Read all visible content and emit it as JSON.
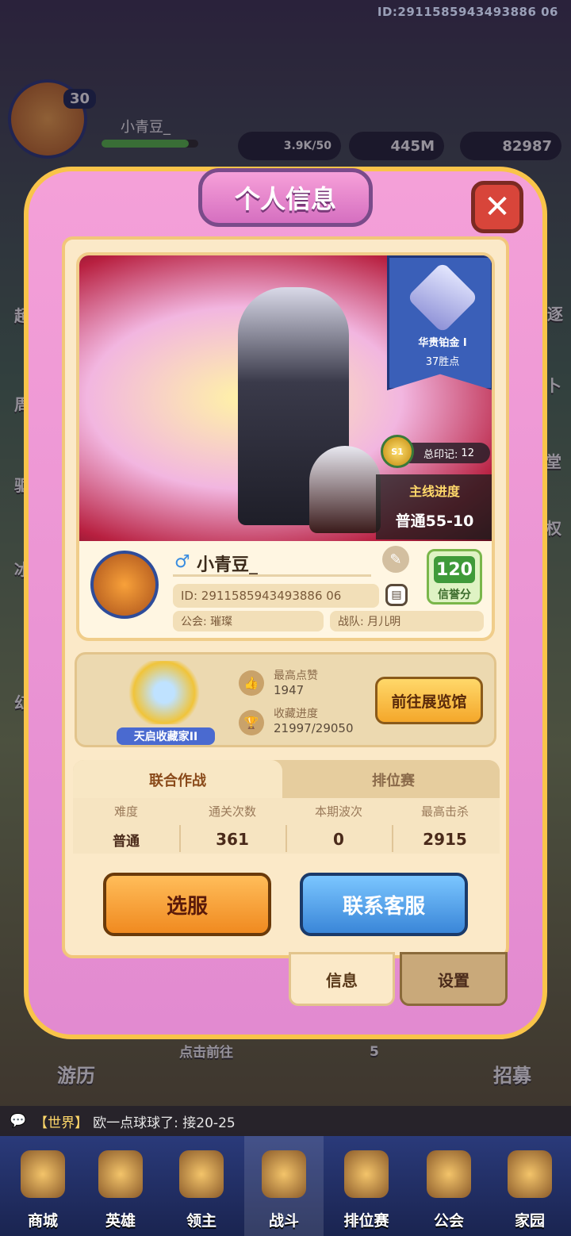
{
  "topbar": {
    "player_id": "ID:2911585943493886 06"
  },
  "hud": {
    "level": "30",
    "name": "小青豆_",
    "res_energy": "3.9K/50",
    "res_gold": "445M",
    "res_gem": "82987"
  },
  "side": {
    "left": [
      "超值",
      "周年",
      "驱逐",
      "冰原",
      "幻灵"
    ],
    "right": [
      "追逐",
      "占卜",
      "课堂",
      "特权"
    ]
  },
  "dialog": {
    "title": "个人信息",
    "close_icon": "close-icon",
    "rank": {
      "name": "华贵铂金 I",
      "points": "37胜点"
    },
    "marks": {
      "season": "S1",
      "label": "总印记:",
      "value": "12"
    },
    "mainline": {
      "title": "主线进度",
      "value": "普通55-10"
    },
    "profile": {
      "gender_icon": "♂",
      "name": "小青豆_",
      "id": "ID: 2911585943493886 06",
      "guild": "公会: 璀璨",
      "team": "战队: 月儿明",
      "credit_value": "120",
      "credit_label": "信誉分"
    },
    "collection": {
      "title": "天启收藏家II",
      "likes_label": "最高点赞",
      "likes_value": "1947",
      "progress_label": "收藏进度",
      "progress_value": "21997/29050",
      "gallery_button": "前往展览馆"
    },
    "tabs": [
      "联合作战",
      "排位赛"
    ],
    "table": {
      "headers": [
        "难度",
        "通关次数",
        "本期波次",
        "最高击杀"
      ],
      "row": [
        "普通",
        "361",
        "0",
        "2915"
      ]
    },
    "buttons": {
      "server": "选服",
      "support": "联系客服"
    },
    "bottom_tabs": {
      "info": "信息",
      "settings": "设置"
    }
  },
  "bg_labels": {
    "travel": "游历",
    "go": "点击前往",
    "recruit": "招募",
    "count": "5"
  },
  "chat": {
    "channel": "【世界】",
    "message": "欧一点球球了: 接20-25"
  },
  "nav": [
    "商城",
    "英雄",
    "领主",
    "战斗",
    "排位赛",
    "公会",
    "家园"
  ],
  "colors": {
    "accent": "#f9c44a",
    "pink": "#f4a0d8",
    "panel": "#fbe9c8",
    "blue": "#3a86d8",
    "orange": "#f08a20"
  }
}
